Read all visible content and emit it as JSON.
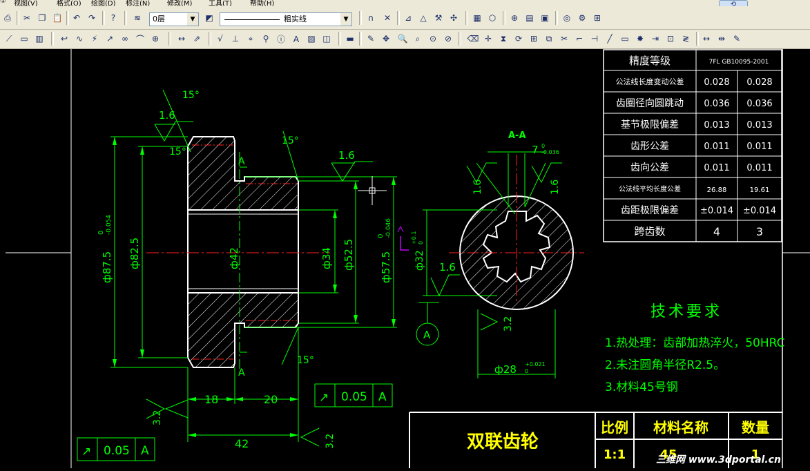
{
  "menu": {
    "items": [
      "视图(V)",
      "格式(O)",
      "绘图(D)",
      "标注(N)",
      "修改(M)",
      "工具(T)",
      "帮助(H)"
    ]
  },
  "toolbar": {
    "layer_value": "0层",
    "linetype_value": "粗实线"
  },
  "icons": [
    "print-icon",
    "cut-icon",
    "copy-icon",
    "paste-icon",
    "undo-icon",
    "redo-icon",
    "help-icon",
    "layer-manager-icon"
  ],
  "drawing": {
    "title": "双联齿轮",
    "material_value": "45",
    "scale_value": "1:1",
    "qty_value": "1",
    "title_block_headers": {
      "scale": "比例",
      "material": "材料名称",
      "qty": "数量"
    },
    "section_label": "A-A",
    "section_marker": "A",
    "cut_label_top": "A",
    "cut_label_bottom": "A",
    "tech_title": "技术要求",
    "tech_notes": [
      "1.热处理：齿部加热淬火，50HRC",
      "2.未注圆角半径R2.5。",
      "3.材料45号钢"
    ],
    "dims": {
      "d87": "ф87.5",
      "d87_tol_up": "0",
      "d87_tol_low": "-0.054",
      "d82": "ф82.5",
      "d42": "ф42",
      "d34": "ф34",
      "d525": "ф52.5",
      "d575": "ф57.5",
      "d575_tol_up": "0",
      "d575_tol_low": "-0.046",
      "d32": "ф32",
      "d32_tol_up": "+0.1",
      "d32_tol_low": "0",
      "d28": "ф28",
      "d28_tol_up": "+0.021",
      "d28_tol_low": "0",
      "w7": "7",
      "w7_tol_up": "0",
      "w7_tol_low": "-0.036",
      "len18": "18",
      "len20": "20",
      "len42": "42",
      "angle15": "15°",
      "rough16": "1.6",
      "rough32": "3.2",
      "runout": "0.05",
      "datum": "A"
    },
    "precision_table": {
      "rows": [
        [
          "精度等级",
          "7FL GB10095-2001"
        ],
        [
          "公法线长度变动公差",
          "0.028",
          "0.028"
        ],
        [
          "齿圈径向圆跳动",
          "0.036",
          "0.036"
        ],
        [
          "基节极限偏差",
          "0.013",
          "0.013"
        ],
        [
          "齿形公差",
          "0.011",
          "0.011"
        ],
        [
          "齿向公差",
          "0.011",
          "0.011"
        ],
        [
          "公法线平均长度公差",
          "26.88",
          "19.61"
        ],
        [
          "齿距极限偏差",
          "±0.014",
          "±0.014"
        ],
        [
          "跨齿数",
          "4",
          "3"
        ]
      ]
    }
  },
  "watermark": "三维网 www.3dportal.cn",
  "colors": {
    "background": "#000000",
    "outline": "#ffffff",
    "dimension": "#00ff00",
    "centerline": "#ff0000",
    "hatch": "#ffffff",
    "text_yellow": "#ffff00",
    "ui_face": "#ece9d8"
  }
}
